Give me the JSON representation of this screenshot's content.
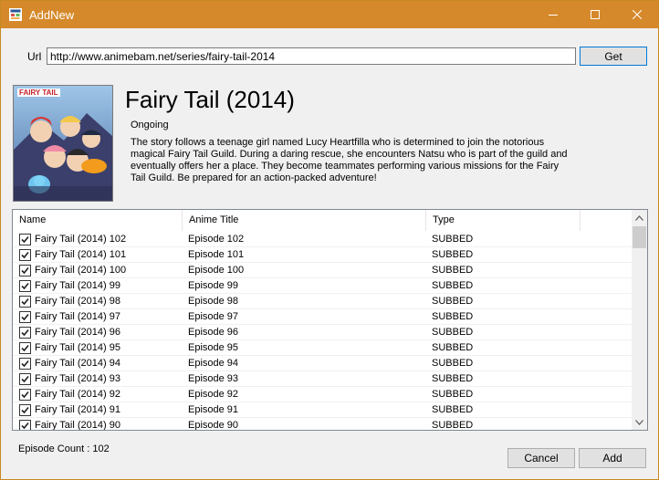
{
  "window": {
    "title": "AddNew"
  },
  "url": {
    "label": "Url",
    "value": "http://www.animebam.net/series/fairy-tail-2014",
    "get_button": "Get"
  },
  "anime": {
    "title": "Fairy Tail (2014)",
    "status": "Ongoing",
    "description": "The story follows a teenage girl named Lucy Heartfilla who is determined to join the notorious magical Fairy Tail Guild. During a daring rescue, she encounters Natsu who is part of the guild and eventually offers her a place. They become teammates performing various missions for the Fairy Tail Guild. Be prepared for an action-packed adventure!",
    "poster_logo": "FAIRY TAIL"
  },
  "list": {
    "columns": {
      "name": "Name",
      "anime_title": "Anime Title",
      "type": "Type"
    },
    "rows": [
      {
        "name": "Fairy Tail (2014) 102",
        "title": "Episode 102",
        "type": "SUBBED",
        "checked": true
      },
      {
        "name": "Fairy Tail (2014) 101",
        "title": "Episode 101",
        "type": "SUBBED",
        "checked": true
      },
      {
        "name": "Fairy Tail (2014) 100",
        "title": "Episode 100",
        "type": "SUBBED",
        "checked": true
      },
      {
        "name": "Fairy Tail (2014) 99",
        "title": "Episode 99",
        "type": "SUBBED",
        "checked": true
      },
      {
        "name": "Fairy Tail (2014) 98",
        "title": "Episode 98",
        "type": "SUBBED",
        "checked": true
      },
      {
        "name": "Fairy Tail (2014) 97",
        "title": "Episode 97",
        "type": "SUBBED",
        "checked": true
      },
      {
        "name": "Fairy Tail (2014) 96",
        "title": "Episode 96",
        "type": "SUBBED",
        "checked": true
      },
      {
        "name": "Fairy Tail (2014) 95",
        "title": "Episode 95",
        "type": "SUBBED",
        "checked": true
      },
      {
        "name": "Fairy Tail (2014) 94",
        "title": "Episode 94",
        "type": "SUBBED",
        "checked": true
      },
      {
        "name": "Fairy Tail (2014) 93",
        "title": "Episode 93",
        "type": "SUBBED",
        "checked": true
      },
      {
        "name": "Fairy Tail (2014) 92",
        "title": "Episode 92",
        "type": "SUBBED",
        "checked": true
      },
      {
        "name": "Fairy Tail (2014) 91",
        "title": "Episode 91",
        "type": "SUBBED",
        "checked": true
      },
      {
        "name": "Fairy Tail (2014) 90",
        "title": "Episode 90",
        "type": "SUBBED",
        "checked": true
      }
    ]
  },
  "footer": {
    "episode_count": "Episode Count : 102",
    "cancel_button": "Cancel",
    "add_button": "Add"
  },
  "colors": {
    "titlebar": "#d5892a",
    "focus_border": "#0078d7"
  },
  "icons": {
    "app": "app-window-icon",
    "minimize": "minimize-icon",
    "maximize": "maximize-icon",
    "close": "close-icon",
    "checkbox": "checkmark-icon",
    "scroll_up": "scroll-up-icon",
    "scroll_down": "scroll-down-icon"
  }
}
